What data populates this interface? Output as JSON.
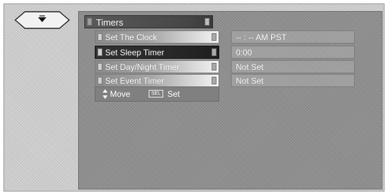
{
  "nav": {
    "icon": "down-arrow-icon"
  },
  "menu": {
    "title": "Timers",
    "items": [
      {
        "label": "Set The Clock",
        "value": "-- : --  AM PST"
      },
      {
        "label": "Set Sleep Timer",
        "value": "0:00"
      },
      {
        "label": "Set Day/Night Timer",
        "value": "Not Set"
      },
      {
        "label": "Set Event Timer",
        "value": "Not Set"
      }
    ],
    "selected_index": 1
  },
  "help": {
    "move_label": "Move",
    "sel_icon_label": "SEL",
    "set_label": "Set"
  },
  "colors": {
    "screen_bg": "#d4d4d4",
    "panel_bg": "#8d8d8d",
    "selected_bg": "#262626",
    "text": "#ffffff"
  }
}
